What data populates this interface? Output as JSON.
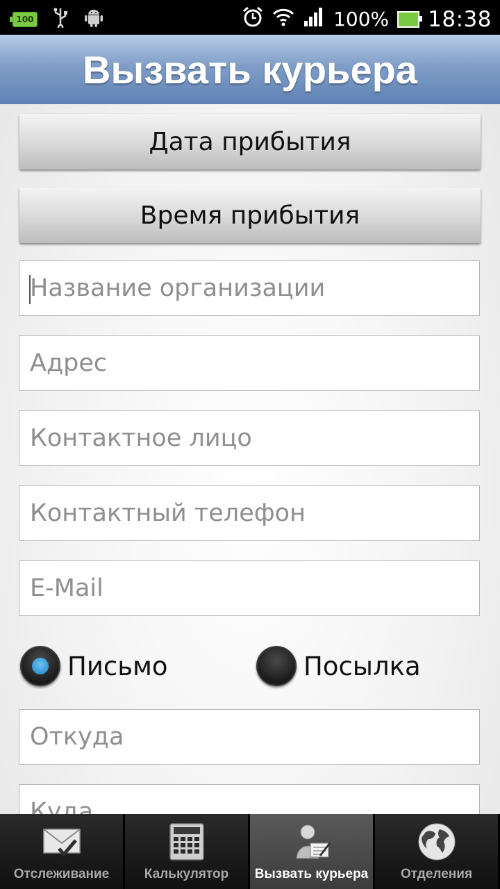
{
  "status_bar": {
    "battery_notification": "100",
    "battery_percent": "100%",
    "time": "18:38"
  },
  "header": {
    "title": "Вызвать курьера"
  },
  "buttons": {
    "arrival_date": "Дата прибытия",
    "arrival_time": "Время прибытия"
  },
  "fields": {
    "organization": {
      "placeholder": "Название организации",
      "value": ""
    },
    "address": {
      "placeholder": "Адрес",
      "value": ""
    },
    "contact_person": {
      "placeholder": "Контактное лицо",
      "value": ""
    },
    "contact_phone": {
      "placeholder": "Контактный телефон",
      "value": ""
    },
    "email": {
      "placeholder": "E-Mail",
      "value": ""
    },
    "from": {
      "placeholder": "Откуда",
      "value": ""
    },
    "to": {
      "placeholder": "Куда",
      "value": ""
    }
  },
  "shipment_type": {
    "options": [
      "Письмо",
      "Посылка"
    ],
    "selected": "Письмо"
  },
  "tabs": [
    {
      "label": "Отслеживание",
      "icon": "envelope-check-icon",
      "active": false
    },
    {
      "label": "Калькулятор",
      "icon": "calculator-icon",
      "active": false
    },
    {
      "label": "Вызвать курьера",
      "icon": "courier-icon",
      "active": true
    },
    {
      "label": "Отделения",
      "icon": "globe-icon",
      "active": false
    }
  ],
  "colors": {
    "header_gradient_top": "#b9cce6",
    "header_gradient_bottom": "#5f82b5",
    "radio_selected": "#2b8fd0"
  }
}
